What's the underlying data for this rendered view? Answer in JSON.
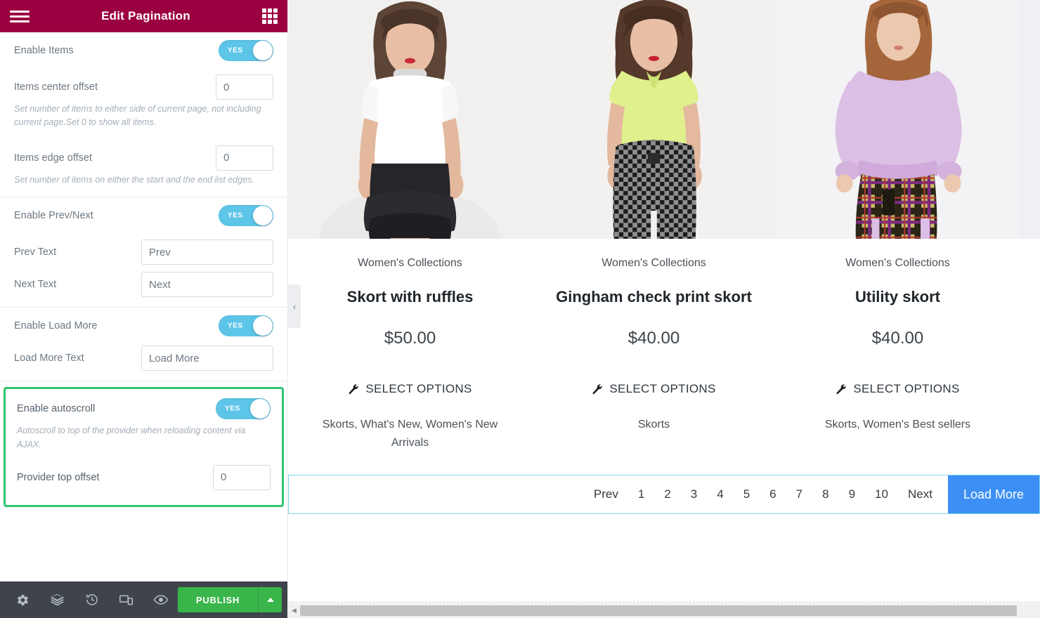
{
  "panel": {
    "title": "Edit Pagination",
    "menu_icon": "hamburger-icon",
    "grid_icon": "grid-icon",
    "sections": [
      {
        "rows": [
          {
            "type": "toggle",
            "label": "Enable Items",
            "value": "YES"
          },
          {
            "type": "number",
            "label": "Items center offset",
            "value": "0"
          },
          {
            "type": "desc",
            "text": "Set number of items to either side of current page, not including current page.Set 0 to show all items."
          },
          {
            "type": "number",
            "label": "Items edge offset",
            "value": "0"
          },
          {
            "type": "desc",
            "text": "Set number of items on either the start and the end list edges."
          }
        ]
      },
      {
        "rows": [
          {
            "type": "toggle",
            "label": "Enable Prev/Next",
            "value": "YES"
          },
          {
            "type": "text",
            "label": "Prev Text",
            "value": "Prev"
          },
          {
            "type": "text",
            "label": "Next Text",
            "value": "Next"
          }
        ]
      },
      {
        "rows": [
          {
            "type": "toggle",
            "label": "Enable Load More",
            "value": "YES"
          },
          {
            "type": "text",
            "label": "Load More Text",
            "value": "Load More"
          }
        ]
      },
      {
        "highlight": true,
        "highlight_color": "#2ec472",
        "rows": [
          {
            "type": "toggle",
            "label": "Enable autoscroll",
            "value": "YES"
          },
          {
            "type": "desc",
            "text": "Autoscroll to top of the provider when reloading content via AJAX."
          },
          {
            "type": "number",
            "label": "Provider top offset",
            "value": "0"
          }
        ]
      }
    ],
    "footer": {
      "icons": [
        "gear-icon",
        "layers-icon",
        "history-icon",
        "responsive-icon",
        "eye-icon"
      ],
      "publish_label": "PUBLISH",
      "publish_color": "#39b54a"
    },
    "header_color": "#9B0040",
    "collapse_handle": "‹"
  },
  "preview": {
    "products": [
      {
        "category": "Women's Collections",
        "title": "Skort with ruffles",
        "price": "$50.00",
        "action": "SELECT OPTIONS",
        "tags": "Skorts, What's New, Women's New Arrivals"
      },
      {
        "category": "Women's Collections",
        "title": "Gingham check print skort",
        "price": "$40.00",
        "action": "SELECT OPTIONS",
        "tags": "Skorts"
      },
      {
        "category": "Women's Collections",
        "title": "Utility skort",
        "price": "$40.00",
        "action": "SELECT OPTIONS",
        "tags": "Skorts, Women's Best sellers"
      }
    ],
    "pagination": {
      "prev": "Prev",
      "pages": [
        "1",
        "2",
        "3",
        "4",
        "5",
        "6",
        "7",
        "8",
        "9",
        "10"
      ],
      "next": "Next",
      "load_more": "Load More",
      "border_color": "#7fd8ee",
      "load_more_color": "#3c8ff5"
    }
  }
}
